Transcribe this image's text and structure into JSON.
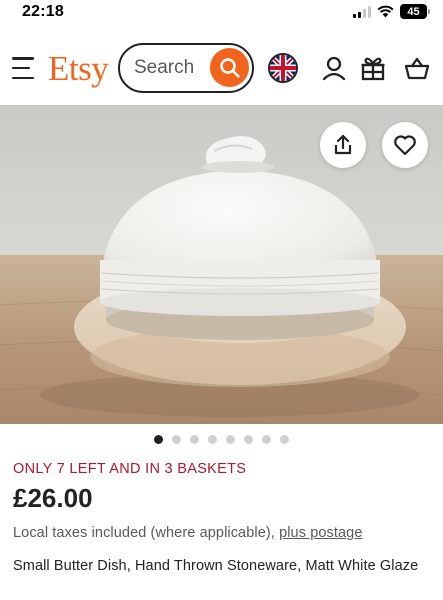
{
  "status_bar": {
    "time": "22:18",
    "battery": "45"
  },
  "header": {
    "logo": "Etsy",
    "search": {
      "placeholder": "Search",
      "value": ""
    },
    "icons": [
      "menu-icon",
      "search-icon",
      "uk-flag-icon",
      "account-icon",
      "gift-icon",
      "basket-icon"
    ]
  },
  "product": {
    "image_alt": "Small white stoneware butter dish with dome lid",
    "actions": [
      "share-icon",
      "heart-icon"
    ],
    "carousel": {
      "total": 8,
      "active": 1
    },
    "stock_note": "ONLY 7 LEFT AND IN 3 BASKETS",
    "price": "£26.00",
    "tax_note": "Local taxes included (where applicable), ",
    "postage_link": "plus postage",
    "title": "Small Butter Dish, Hand Thrown Stoneware, Matt White Glaze"
  },
  "colors": {
    "brand": "#F1641E",
    "stock_note": "#A61A2E",
    "text": "#222222",
    "muted": "#595959"
  }
}
